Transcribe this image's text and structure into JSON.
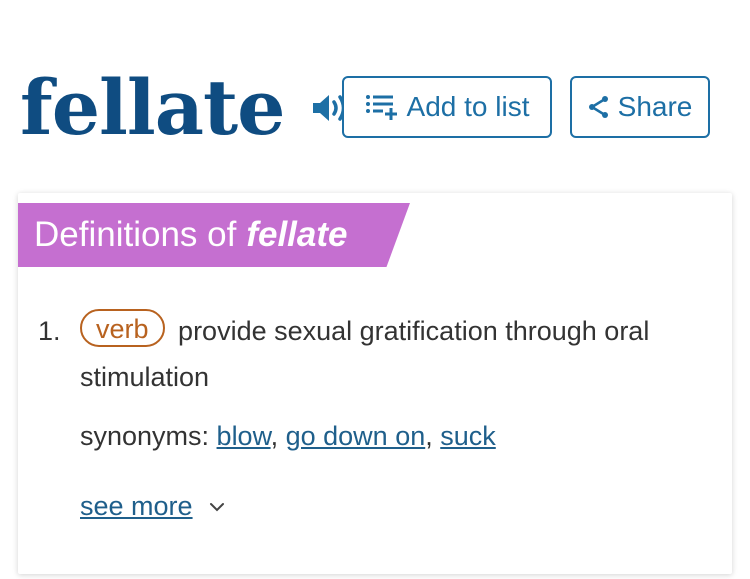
{
  "word": "fellate",
  "actions": {
    "add_to_list": "Add to list",
    "share": "Share"
  },
  "definitions": {
    "banner_prefix": "Definitions of",
    "banner_word": "fellate",
    "items": [
      {
        "number": "1.",
        "part_of_speech": "verb",
        "text": "provide sexual gratification through oral stimulation",
        "synonyms_label": "synonyms:",
        "synonyms": [
          "blow",
          "go down on",
          "suck"
        ]
      }
    ],
    "see_more": "see more"
  },
  "icons": {
    "audio": "speaker-icon",
    "add_to_list": "list-add-icon",
    "share": "share-icon",
    "see_more": "chevron-down-icon"
  },
  "colors": {
    "word": "#0f4c81",
    "accent": "#1d6fa5",
    "banner": "#c56fd0",
    "pos_badge": "#b8621f",
    "link": "#1f5f8b"
  }
}
